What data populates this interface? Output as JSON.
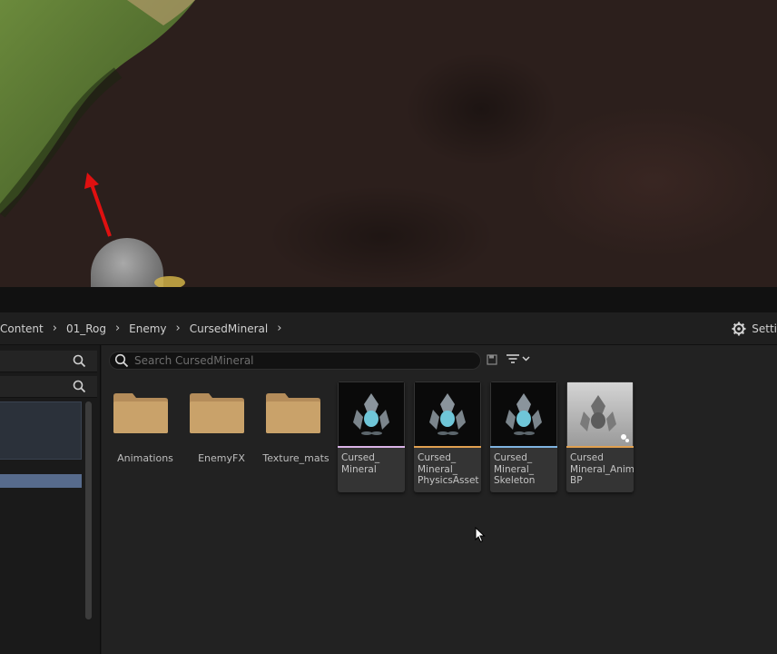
{
  "breadcrumb": {
    "items": [
      "Content",
      "01_Rog",
      "Enemy",
      "CursedMineral"
    ],
    "settings_label": "Setti"
  },
  "search": {
    "placeholder": "Search CursedMineral"
  },
  "folders": [
    {
      "name": "Animations"
    },
    {
      "name": "EnemyFX"
    },
    {
      "name": "Texture_mats"
    }
  ],
  "assets": [
    {
      "label": "Cursed_\nMineral",
      "accent": "#d9b3e6",
      "thumb": "dark"
    },
    {
      "label": "Cursed_\nMineral_\nPhysicsAsset",
      "accent": "#e0a050",
      "thumb": "dark"
    },
    {
      "label": "Cursed_\nMineral_\nSkeleton",
      "accent": "#7fb3e0",
      "thumb": "dark"
    },
    {
      "label": "Cursed\nMineral_Anim\nBP",
      "accent": "#e0a050",
      "thumb": "light"
    }
  ],
  "colors": {
    "accent_selected": "#576b8c",
    "folder": "#c9a26a"
  },
  "icons": {
    "search": "search-icon",
    "settings": "gear-icon",
    "filter": "filter-icon",
    "save": "save-icon"
  }
}
